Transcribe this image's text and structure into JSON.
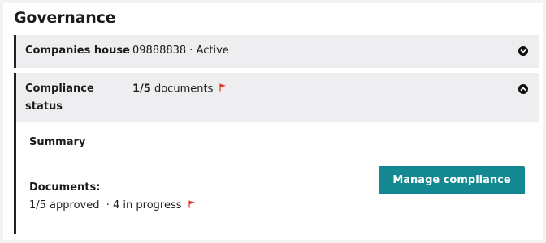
{
  "section": {
    "title": "Governance"
  },
  "companies_house": {
    "label": "Companies house",
    "value": "09888838 · Active",
    "toggle_icon": "chevron-down-icon"
  },
  "compliance": {
    "label": "Compliance status",
    "count": "1/5",
    "count_suffix": " documents",
    "flag_icon": "red-flag-icon",
    "flag_color": "#e0301e",
    "toggle_icon": "chevron-up-icon"
  },
  "summary": {
    "title": "Summary",
    "documents_label": "Documents:",
    "documents_value": "1/5 approved  · 4 in progress",
    "manage_button": "Manage compliance",
    "button_color": "#138891"
  }
}
